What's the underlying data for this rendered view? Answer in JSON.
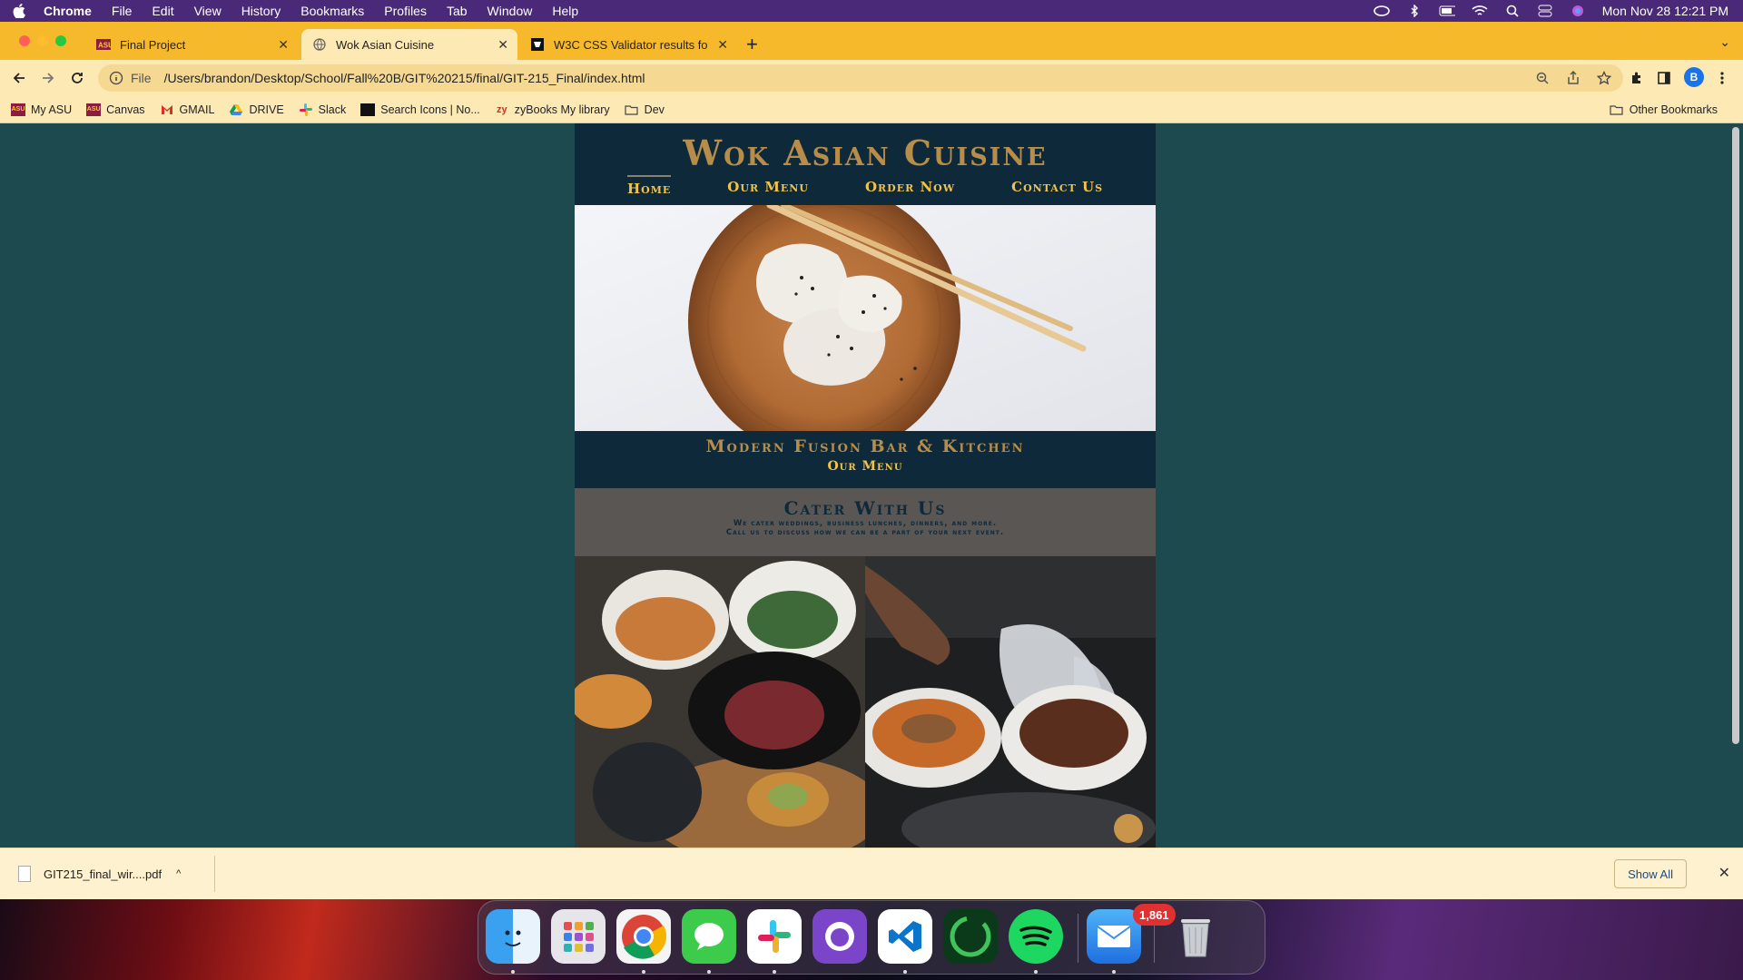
{
  "menubar": {
    "app": "Chrome",
    "items": [
      "File",
      "Edit",
      "View",
      "History",
      "Bookmarks",
      "Profiles",
      "Tab",
      "Window",
      "Help"
    ],
    "clock": "Mon Nov 28  12:21 PM"
  },
  "tabs": [
    {
      "title": "Final Project",
      "favicon": "asu-icon",
      "active": false
    },
    {
      "title": "Wok Asian Cuisine",
      "favicon": "globe-icon",
      "active": true
    },
    {
      "title": "W3C CSS Validator results for",
      "favicon": "w3c-icon",
      "active": false
    }
  ],
  "omnibox": {
    "scheme": "File",
    "url": "/Users/brandon/Desktop/School/Fall%20B/GIT%20215/final/GIT-215_Final/index.html"
  },
  "profile_initial": "B",
  "bookmarks": [
    {
      "label": "My ASU",
      "icon": "asu-icon"
    },
    {
      "label": "Canvas",
      "icon": "asu-icon"
    },
    {
      "label": "GMAIL",
      "icon": "gmail-icon"
    },
    {
      "label": "DRIVE",
      "icon": "drive-icon"
    },
    {
      "label": "Slack",
      "icon": "slack-icon"
    },
    {
      "label": "Search Icons | No...",
      "icon": "noun-project-icon"
    },
    {
      "label": "zyBooks My library",
      "icon": "zybooks-icon"
    },
    {
      "label": "Dev",
      "icon": "folder-icon"
    }
  ],
  "other_bookmarks": "Other Bookmarks",
  "site": {
    "title": "Wok Asian Cuisine",
    "nav": [
      "Home",
      "Our Menu",
      "Order Now",
      "Contact Us"
    ],
    "tagline": "Modern Fusion Bar & Kitchen",
    "menu_link": "Our Menu",
    "cater_title": "Cater With Us",
    "cater_line1": "We cater weddings, business lunches, dinners, and more.",
    "cater_line2": "Call us to discuss how we can be a part of your next event."
  },
  "download": {
    "filename": "GIT215_final_wir....pdf",
    "show_all": "Show All"
  },
  "dock": {
    "apps": [
      "finder",
      "launchpad",
      "chrome",
      "messages",
      "slack",
      "github-desktop",
      "vscode",
      "spotify-like",
      "spotify",
      "mail",
      "trash"
    ],
    "mail_badge": "1,861"
  },
  "colors": {
    "page_bg": "#1c4a4f",
    "header_bg": "#0e2a3a",
    "gold": "#b88d4a",
    "nav_yellow": "#f2c34a",
    "cater_bg": "#5a5654",
    "tab_strip": "#f6b92b"
  }
}
